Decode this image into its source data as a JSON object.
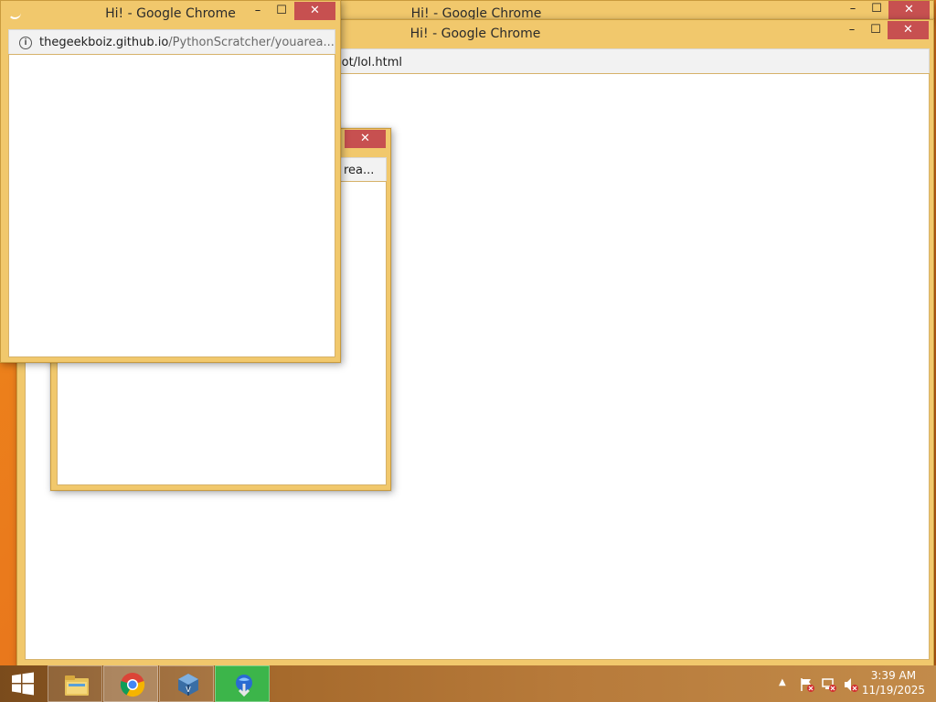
{
  "windows": {
    "back": {
      "title": "Hi! - Google Chrome"
    },
    "main": {
      "title": "Hi! - Google Chrome",
      "address_path_visible": "iot/lol.html"
    },
    "middle": {
      "address_visible": "rea..."
    },
    "front": {
      "title": "Hi! - Google Chrome",
      "address_host": "thegeekboiz.github.io",
      "address_path": "/PythonScratcher/youarea..."
    },
    "controls": {
      "minimize": "–",
      "maximize": "☐",
      "close": "✕"
    }
  },
  "taskbar": {
    "apps": [
      {
        "name": "file-explorer",
        "icon": "folder-icon"
      },
      {
        "name": "google-chrome",
        "icon": "chrome-icon"
      },
      {
        "name": "virtualbox",
        "icon": "virtualbox-icon"
      },
      {
        "name": "internet-download-manager",
        "icon": "idm-icon"
      }
    ],
    "tray": {
      "time": "3:39 AM",
      "date": "11/19/2025"
    }
  }
}
